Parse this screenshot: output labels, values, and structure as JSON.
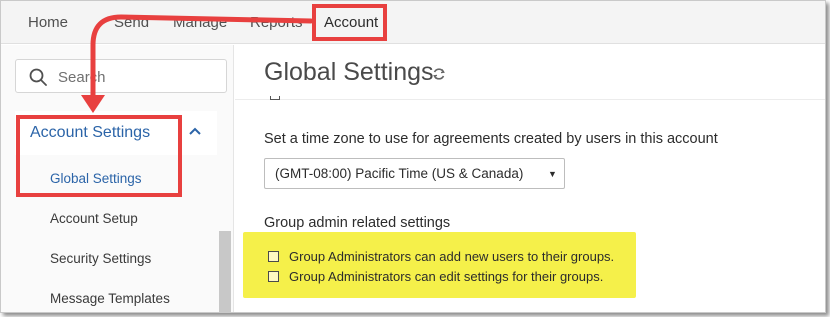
{
  "topnav": {
    "home": "Home",
    "send": "Send",
    "manage": "Manage",
    "reports": "Reports",
    "account": "Account"
  },
  "sidebar": {
    "search_placeholder": "Search",
    "section_label": "Account Settings",
    "items": [
      {
        "label": "Global Settings",
        "active": true
      },
      {
        "label": "Account Setup"
      },
      {
        "label": "Security Settings"
      },
      {
        "label": "Message Templates"
      }
    ]
  },
  "main": {
    "title": "Global Settings",
    "timezone_label": "Set a time zone to use for agreements created by users in this account",
    "timezone_value": "(GMT-08:00) Pacific Time (US & Canada)",
    "group_heading": "Group admin related settings",
    "checkboxes": [
      {
        "label": "Group Administrators can add new users to their groups.",
        "checked": false
      },
      {
        "label": "Group Administrators can edit settings for their groups.",
        "checked": false
      }
    ]
  },
  "colors": {
    "accent_blue": "#2b64a8",
    "annotation_red": "#e8403f",
    "highlight_yellow": "#f5f04a"
  },
  "icons": [
    "search-icon",
    "chevron-up-icon",
    "refresh-icon",
    "dropdown-arrow-icon"
  ]
}
